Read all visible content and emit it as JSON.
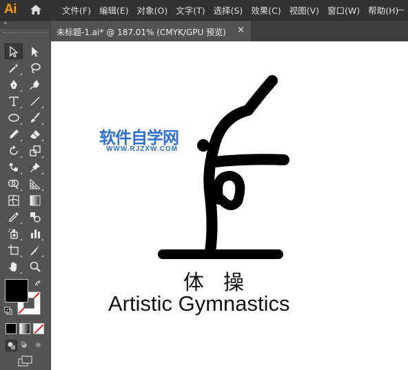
{
  "app": {
    "logo": "Ai"
  },
  "menu": [
    "文件(F)",
    "编辑(E)",
    "对象(O)",
    "文字(T)",
    "选择(S)",
    "效果(C)",
    "视图(V)",
    "窗口(W)",
    "帮助(H)"
  ],
  "window_controls": {
    "minimize": "—"
  },
  "toolbar": {
    "collapse_label": "«"
  },
  "document_tab": {
    "title": "未标题-1.ai* @ 187.01% (CMYK/GPU 预览)",
    "close": "×"
  },
  "artwork": {
    "chinese_title": "体操",
    "english_title": "Artistic Gymnastics",
    "watermark_cn": "软件自学网",
    "watermark_url": "WWW.RJZXW.COM"
  },
  "colors": {
    "fill": "#000000",
    "stroke": "none",
    "accent": "#ff9a00",
    "watermark": "#2f6fd1"
  }
}
